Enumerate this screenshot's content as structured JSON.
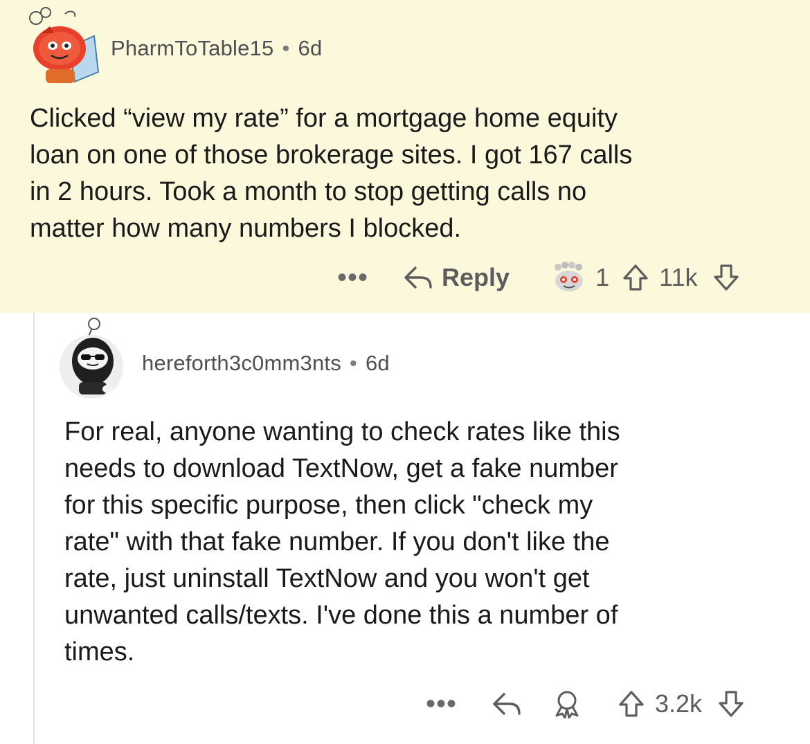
{
  "comment1": {
    "username": "PharmToTable15",
    "age": "6d",
    "text": "Clicked “view my rate” for a mortgage home equity loan on one of those brokerage sites. I got 167 calls in 2 hours. Took a month to stop getting calls no matter how many numbers I blocked.",
    "lines": [
      "Clicked “view my rate” for a mortgage home equity",
      "loan on one of those brokerage sites. I got 167 calls",
      "in 2 hours. Took a month to stop getting calls no",
      "matter how many numbers I blocked."
    ],
    "more_label": "•••",
    "reply_label": "Reply",
    "award_count": "1",
    "vote_count": "11k",
    "highlight_color": "#fbf8dc"
  },
  "comment2": {
    "username": "hereforth3c0mm3nts",
    "age": "6d",
    "lines": [
      "For real, anyone wanting to check rates like this",
      "needs to download TextNow, get a fake number",
      "for this specific purpose, then click \"check my",
      "rate\" with that fake number. If you don't like the",
      "rate, just uninstall TextNow and you won't get",
      "unwanted calls/texts. I've done this a number of",
      "times."
    ],
    "more_label": "•••",
    "vote_count": "3.2k"
  },
  "icons": {
    "reply": "reply-arrow-icon",
    "award": "award-icon",
    "upvote": "upvote-arrow-icon",
    "downvote": "downvote-arrow-icon",
    "avatar1": "snoo-avatar-red-icon",
    "avatar2": "snoo-avatar-hooded-icon"
  }
}
